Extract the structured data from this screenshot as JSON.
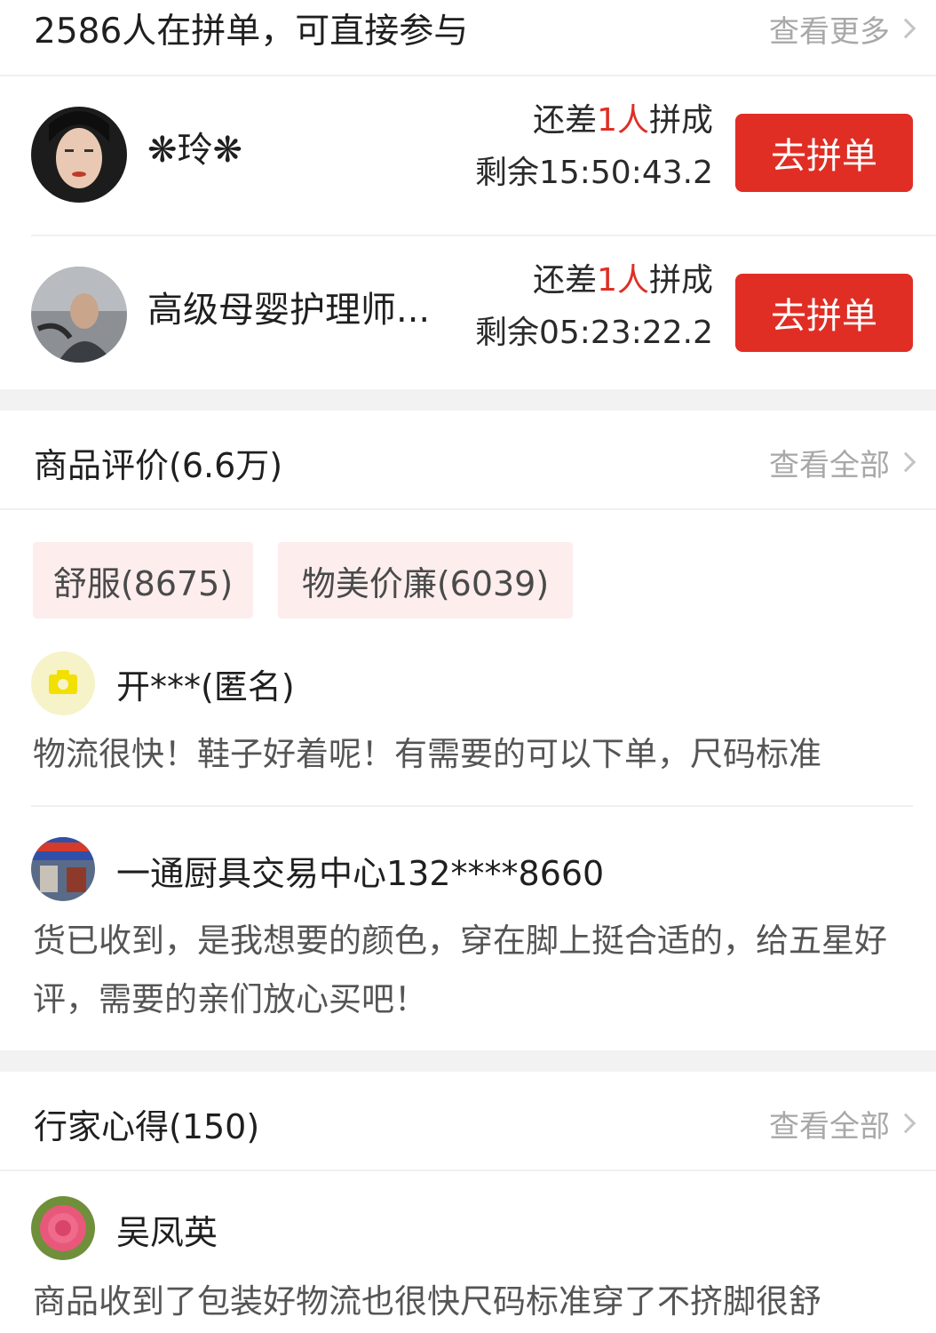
{
  "group_buy": {
    "headline": "2586人在拼单，可直接参与",
    "more_label": "查看更多",
    "groups": [
      {
        "name": "❋玲❋",
        "need_prefix": "还差",
        "need_count": "1人",
        "need_suffix": "拼成",
        "remaining": "剩余15:50:43.2",
        "button": "去拼单"
      },
      {
        "name": "高级母婴护理师...",
        "need_prefix": "还差",
        "need_count": "1人",
        "need_suffix": "拼成",
        "remaining": "剩余05:23:22.2",
        "button": "去拼单"
      }
    ]
  },
  "reviews": {
    "title": "商品评价(6.6万)",
    "more_label": "查看全部",
    "tags": [
      "舒服(8675)",
      "物美价廉(6039)"
    ],
    "items": [
      {
        "user": "开***(匿名)",
        "text": "物流很快！鞋子好着呢！有需要的可以下单，尺码标准"
      },
      {
        "user": "一通厨具交易中心132****8660",
        "text": "货已收到，是我想要的颜色，穿在脚上挺合适的，给五星好评，需要的亲们放心买吧！"
      }
    ]
  },
  "experts": {
    "title": "行家心得(150)",
    "more_label": "查看全部",
    "items": [
      {
        "user": "吴凤英",
        "text": "商品收到了包装好物流也很快尺码标准穿了不挤脚很舒"
      }
    ]
  },
  "colors": {
    "accent_red": "#e02e24",
    "tag_bg": "#fdeded",
    "muted_text": "#a8a8a8"
  }
}
